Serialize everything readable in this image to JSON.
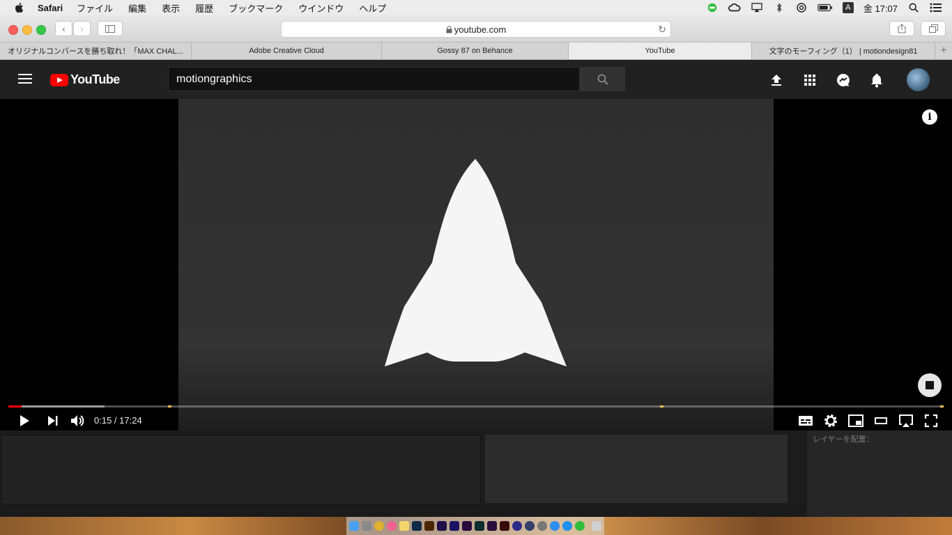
{
  "menubar": {
    "app": "Safari",
    "items": [
      "ファイル",
      "編集",
      "表示",
      "履歴",
      "ブックマーク",
      "ウインドウ",
      "ヘルプ"
    ],
    "input_indicator": "A",
    "clock": "金 17:07"
  },
  "browser": {
    "url": "youtube.com",
    "tabs": [
      {
        "label": "オリジナルコンバースを勝ち取れ！「MAX CHAL..."
      },
      {
        "label": "Adobe Creative Cloud"
      },
      {
        "label": "Gossy 87 on Behance"
      },
      {
        "label": "YouTube",
        "active": true
      },
      {
        "label": "文字のモーフィング（1） | motiondesign81"
      }
    ]
  },
  "youtube": {
    "logo_text": "YouTube",
    "search_value": "motiongraphics",
    "player": {
      "time": "0:15 / 17:24",
      "played_fraction": 0.014,
      "buffered_fraction": 0.103,
      "chapter_marks": [
        0.172,
        0.698,
        0.998
      ]
    }
  },
  "editor": {
    "align_label": "レイヤーを配置："
  },
  "colors": {
    "yt_red": "#ff0000",
    "yt_header": "#212121",
    "chapter_mark": "#f3c35c"
  }
}
